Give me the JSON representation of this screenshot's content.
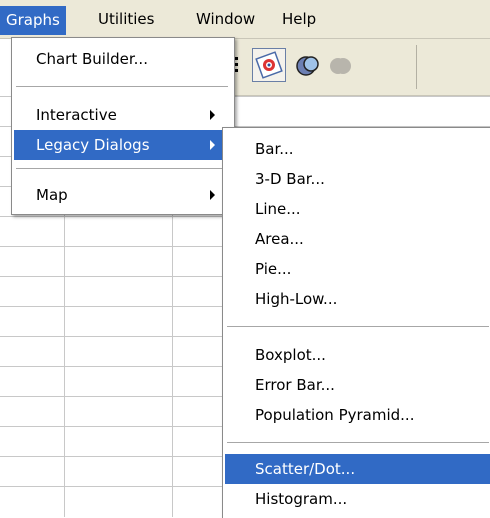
{
  "menubar": {
    "items": [
      {
        "label": "Graphs",
        "active": true
      },
      {
        "label": "Utilities"
      },
      {
        "label": "Window"
      },
      {
        "label": "Help"
      }
    ]
  },
  "toolbar": {
    "icons": [
      "toolbar-grip-icon",
      "chart-target-icon",
      "scatter-circles-icon",
      "gray-circle-icon"
    ]
  },
  "graphs_menu": {
    "items": [
      {
        "label": "Chart Builder..."
      },
      {
        "label": "Interactive",
        "submenu": true
      },
      {
        "label": "Legacy Dialogs",
        "submenu": true,
        "selected": true
      },
      {
        "label": "Map",
        "submenu": true
      }
    ]
  },
  "legacy_menu": {
    "items": [
      {
        "label": "Bar..."
      },
      {
        "label": "3-D Bar..."
      },
      {
        "label": "Line..."
      },
      {
        "label": "Area..."
      },
      {
        "label": "Pie..."
      },
      {
        "label": "High-Low..."
      },
      {
        "label": "Boxplot..."
      },
      {
        "label": "Error Bar..."
      },
      {
        "label": "Population Pyramid..."
      },
      {
        "label": "Scatter/Dot...",
        "selected": true
      },
      {
        "label": "Histogram..."
      }
    ]
  },
  "colors": {
    "menubar_bg": "#ece9d8",
    "highlight": "#316ac5",
    "highlight_text": "#ffffff",
    "grid_line": "#c8c8c8"
  }
}
